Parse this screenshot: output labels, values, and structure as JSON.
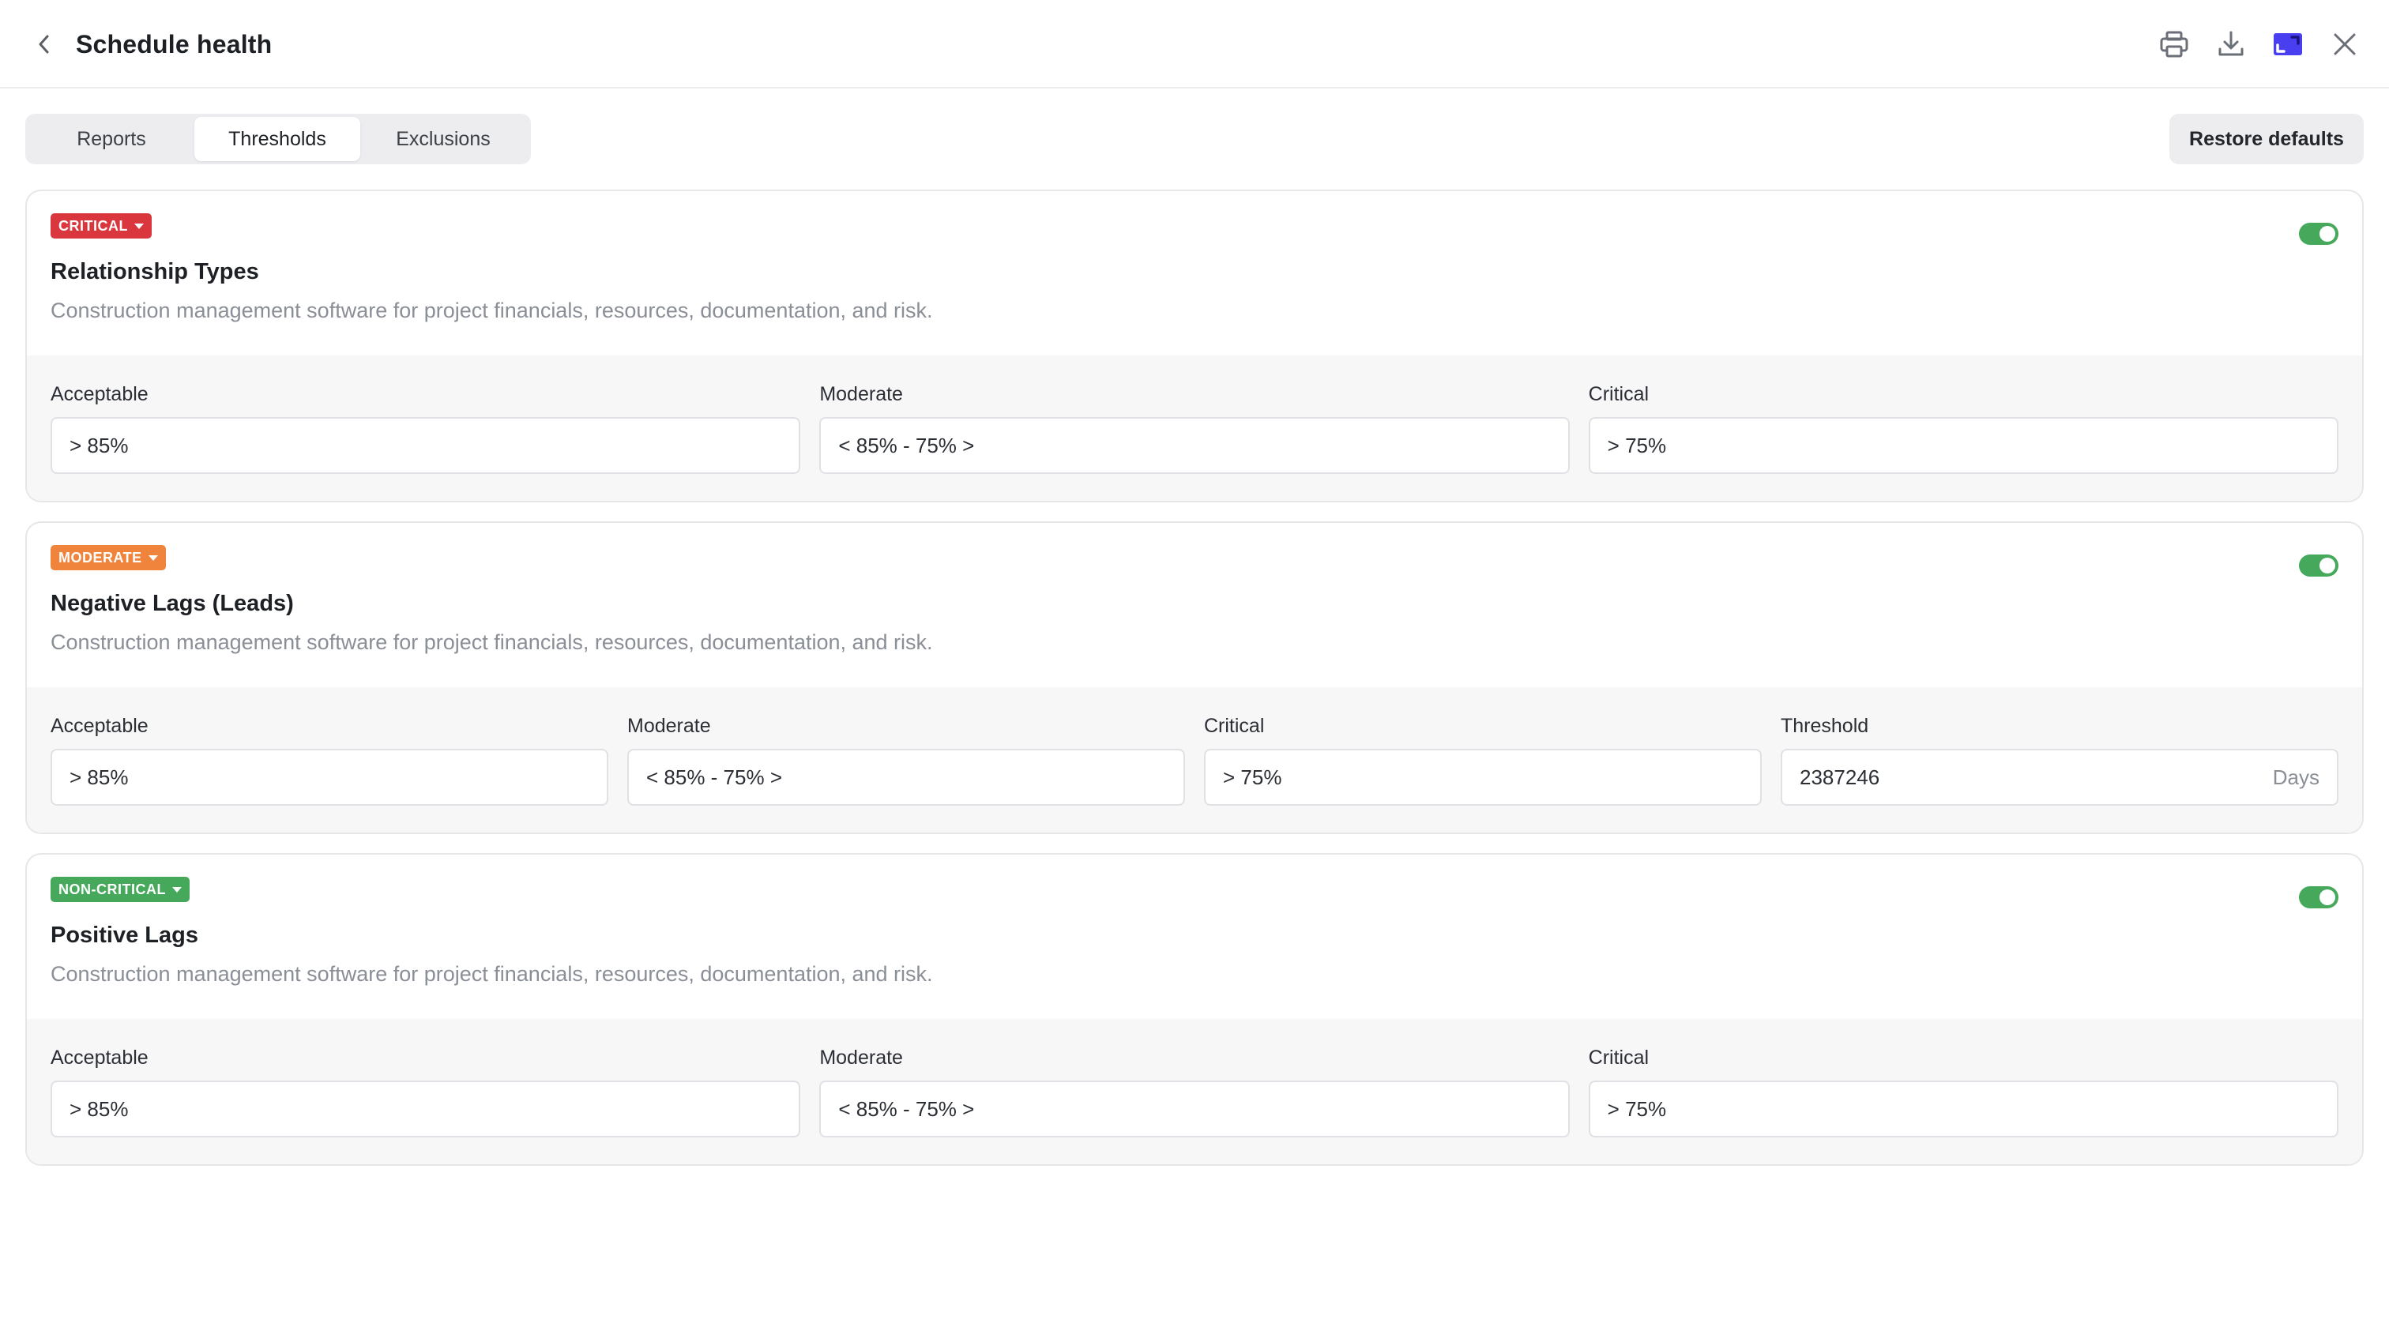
{
  "header": {
    "title": "Schedule health",
    "actions": {
      "print_icon": "print-icon",
      "download_icon": "download-icon",
      "window_icon": "window-icon",
      "close_icon": "close-icon"
    }
  },
  "tabs": [
    {
      "label": "Reports",
      "active": false
    },
    {
      "label": "Thresholds",
      "active": true
    },
    {
      "label": "Exclusions",
      "active": false
    }
  ],
  "restore_label": "Restore defaults",
  "colors": {
    "critical": "#d9363e",
    "moderate": "#f0843c",
    "non_critical": "#45a85a",
    "toggle_on": "#45a85a",
    "accent": "#4a3ff0"
  },
  "cards": [
    {
      "badge": "CRITICAL",
      "enabled": true,
      "title": "Relationship Types",
      "description": "Construction management software for project financials, resources, documentation, and risk.",
      "fields": [
        {
          "label": "Acceptable",
          "value": "> 85%"
        },
        {
          "label": "Moderate",
          "value": "< 85% - 75% >"
        },
        {
          "label": "Critical",
          "value": "> 75%"
        }
      ]
    },
    {
      "badge": "MODERATE",
      "enabled": true,
      "title": "Negative Lags (Leads)",
      "description": "Construction management software for project financials, resources, documentation, and risk.",
      "fields": [
        {
          "label": "Acceptable",
          "value": "> 85%"
        },
        {
          "label": "Moderate",
          "value": "< 85% - 75% >"
        },
        {
          "label": "Critical",
          "value": "> 75%"
        },
        {
          "label": "Threshold",
          "value": "2387246",
          "suffix": "Days"
        }
      ]
    },
    {
      "badge": "NON-CRITICAL",
      "enabled": true,
      "title": "Positive Lags",
      "description": "Construction management software for project financials, resources, documentation, and risk.",
      "fields": [
        {
          "label": "Acceptable",
          "value": "> 85%"
        },
        {
          "label": "Moderate",
          "value": "< 85% - 75% >"
        },
        {
          "label": "Critical",
          "value": "> 75%"
        }
      ]
    }
  ]
}
